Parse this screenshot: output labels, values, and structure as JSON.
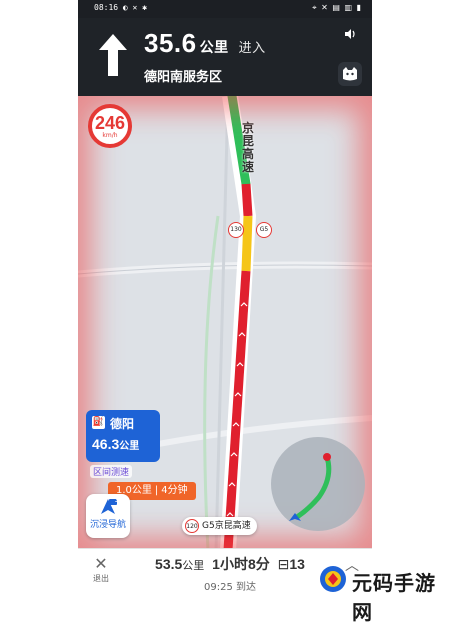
{
  "status_bar": {
    "time": "08:16 ◐ ✕ ✱",
    "right_icons": "⌖ ✕ ▤ ▥ ▮"
  },
  "guidance": {
    "turn_icon": "straight-arrow-icon",
    "distance_value": "35.6",
    "distance_unit": "公里",
    "action": "进入",
    "target_road": "德阳南服务区"
  },
  "speed_limit": {
    "value": "246",
    "unit": "km/h"
  },
  "map_labels": {
    "highway_name": "京昆高速",
    "small_sign_1": "130",
    "small_sign_2": "G5"
  },
  "exit_card": {
    "icon": "service-area-icon",
    "name": "德阳",
    "distance": "46.3",
    "distance_unit": "公里"
  },
  "camera_tag": "区间测速",
  "segment_pill": {
    "distance": "1.0公里",
    "time": "4分钟"
  },
  "immersive_button": {
    "icon_label": "3D",
    "label": "沉浸导航"
  },
  "road_sign": {
    "badge": "120",
    "name": "G5京昆高速"
  },
  "bottom_bar": {
    "exit_label": "退出",
    "remaining_distance": "53.5",
    "remaining_distance_unit": "公里",
    "remaining_time": "1小时8分",
    "traffic_lights": "13",
    "eta": "09:25 到达"
  },
  "watermark": {
    "text": "元码手游网"
  },
  "colors": {
    "header_bg": "#1f2328",
    "route_green": "#2fbf5a",
    "route_yellow": "#f5c518",
    "route_red": "#e0202e",
    "accent_blue": "#1e63d6",
    "warning_red": "#e53935"
  }
}
